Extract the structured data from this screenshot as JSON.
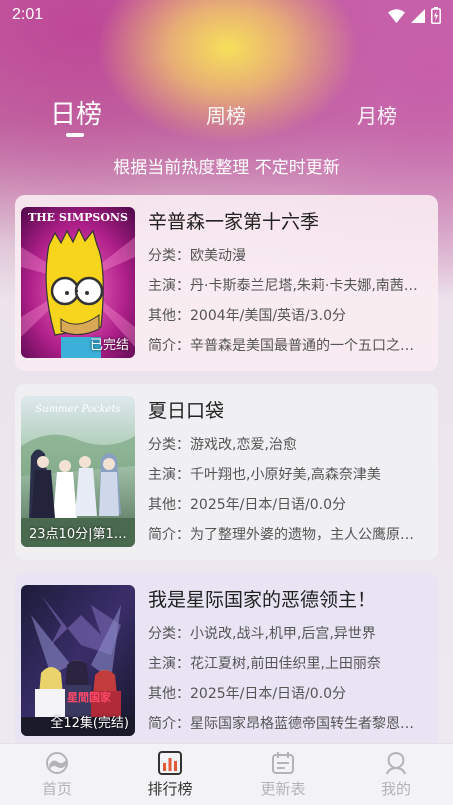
{
  "status_bar": {
    "time": "2:01"
  },
  "tabs": [
    {
      "label": "日榜",
      "active": true
    },
    {
      "label": "周榜",
      "active": false
    },
    {
      "label": "月榜",
      "active": false
    }
  ],
  "subtitle": "根据当前热度整理 不定时更新",
  "cards": [
    {
      "title": "辛普森一家第十六季",
      "category": "分类：欧美动漫",
      "cast": "主演：丹·卡斯泰兰尼塔,朱莉·卡夫娜,南茜…",
      "other": "其他：2004年/美国/英语/3.0分",
      "intro": "简介：辛普森是美国最普通的一个五口之…",
      "badge": "已完结",
      "poster_text": "THE SIMPSONS"
    },
    {
      "title": "夏日口袋",
      "category": "分类：游戏改,恋爱,治愈",
      "cast": "主演：千叶翔也,小原好美,高森奈津美",
      "other": "其他：2025年/日本/日语/0.0分",
      "intro": "简介：为了整理外婆的遗物，主人公鹰原…",
      "badge": "23点10分|第12…",
      "poster_text": "Summer Pockets"
    },
    {
      "title": "我是星际国家的恶德领主！",
      "category": "分类：小说改,战斗,机甲,后宫,异世界",
      "cast": "主演：花江夏树,前田佳织里,上田丽奈",
      "other": "其他：2025年/日本/日语/0.0分",
      "intro": "简介：星际国家昂格蓝德帝国转生者黎恩…",
      "badge": "全12集(完结)",
      "poster_text": "星間国家"
    }
  ],
  "bottom_nav": [
    {
      "label": "首页",
      "icon": "home-planet-icon",
      "active": false
    },
    {
      "label": "排行榜",
      "icon": "ranking-chart-icon",
      "active": true
    },
    {
      "label": "更新表",
      "icon": "calendar-icon",
      "active": false
    },
    {
      "label": "我的",
      "icon": "profile-icon",
      "active": false
    }
  ],
  "colors": {
    "accent": "#333333",
    "inactive": "#b4b4b8",
    "tab_text": "#ffffff"
  }
}
